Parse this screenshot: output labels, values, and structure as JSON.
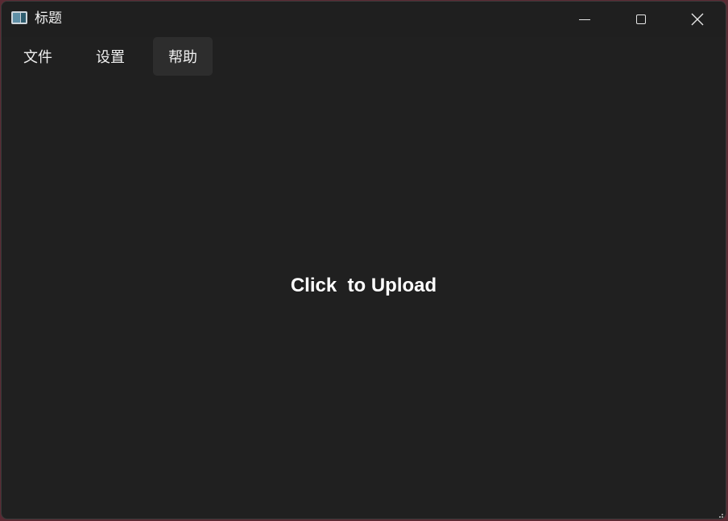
{
  "window": {
    "title": "标题",
    "controls": {
      "minimize": "minimize-icon",
      "maximize": "maximize-icon",
      "close": "close-icon"
    }
  },
  "menu": {
    "items": [
      {
        "label": "文件"
      },
      {
        "label": "设置"
      },
      {
        "label": "帮助",
        "state": "hovered"
      }
    ]
  },
  "main": {
    "upload_label": "Click  to Upload"
  },
  "colors": {
    "window_bg": "#202020",
    "hover_bg": "#2d2d2d",
    "text": "#ffffff"
  }
}
